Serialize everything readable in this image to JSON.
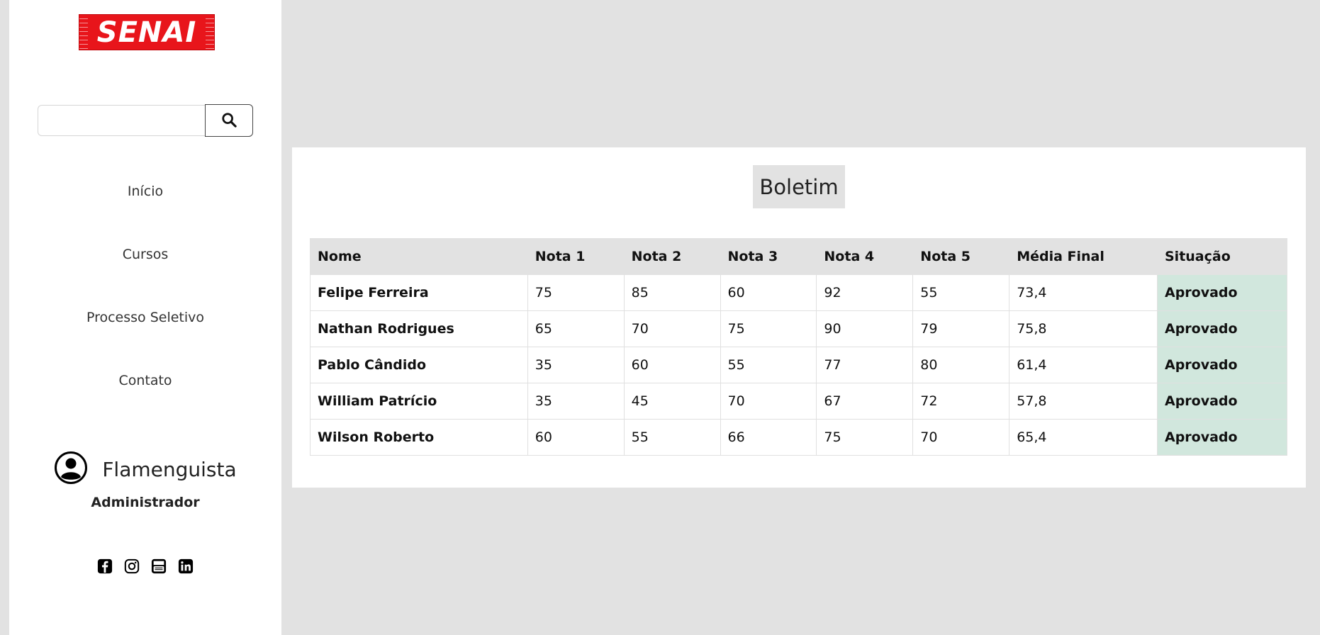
{
  "brand": {
    "logo_text": "SENAI"
  },
  "search": {
    "value": "",
    "placeholder": ""
  },
  "nav": [
    {
      "label": "Início"
    },
    {
      "label": "Cursos"
    },
    {
      "label": "Processo Seletivo"
    },
    {
      "label": "Contato"
    }
  ],
  "user": {
    "name": "Flamenguista",
    "role": "Administrador"
  },
  "social_icons": [
    "facebook-icon",
    "instagram-icon",
    "youtube-icon",
    "linkedin-icon"
  ],
  "main": {
    "title": "Boletim",
    "columns": [
      "Nome",
      "Nota 1",
      "Nota 2",
      "Nota 3",
      "Nota 4",
      "Nota 5",
      "Média Final",
      "Situação"
    ],
    "rows": [
      [
        "Felipe Ferreira",
        "75",
        "85",
        "60",
        "92",
        "55",
        "73,4",
        "Aprovado"
      ],
      [
        "Nathan Rodrigues",
        "65",
        "70",
        "75",
        "90",
        "79",
        "75,8",
        "Aprovado"
      ],
      [
        "Pablo Cândido",
        "35",
        "60",
        "55",
        "77",
        "80",
        "61,4",
        "Aprovado"
      ],
      [
        "William Patrício",
        "35",
        "45",
        "70",
        "67",
        "72",
        "57,8",
        "Aprovado"
      ],
      [
        "Wilson Roberto",
        "60",
        "55",
        "66",
        "75",
        "70",
        "65,4",
        "Aprovado"
      ]
    ]
  },
  "colors": {
    "page_bg": "#e2e2e2",
    "sidebar_bg": "#ffffff",
    "logo_red": "#e8151b",
    "status_bg": "#d1e7dd"
  }
}
